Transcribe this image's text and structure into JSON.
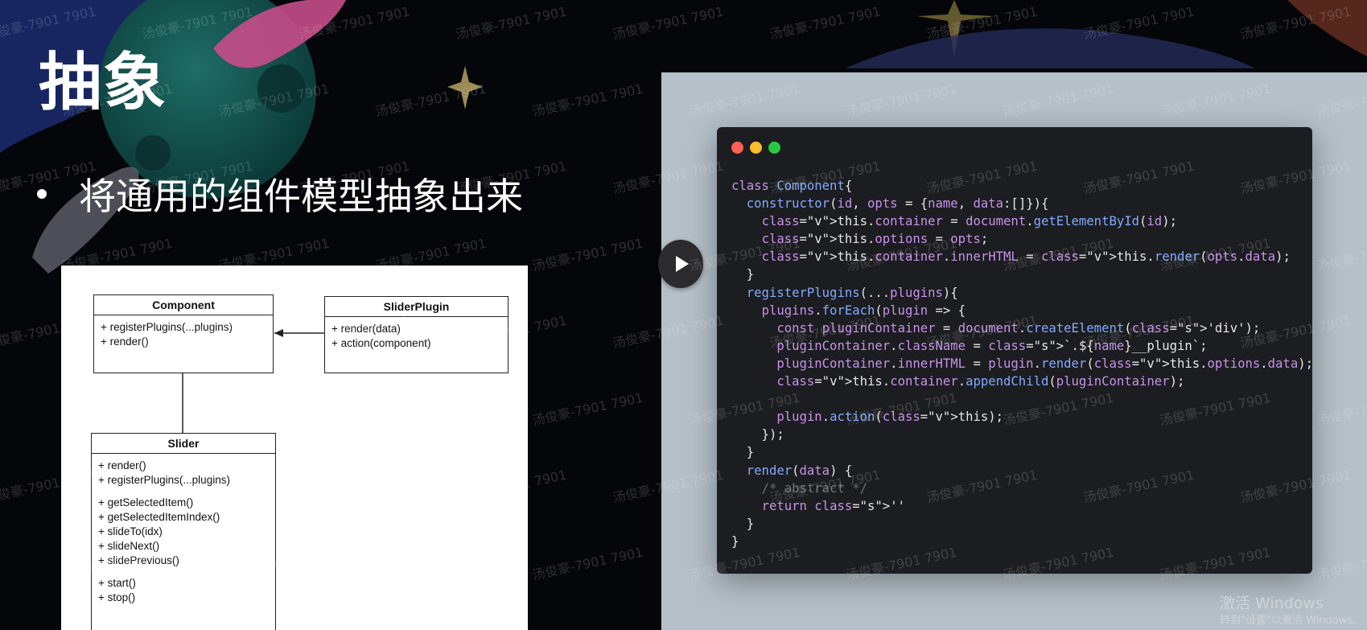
{
  "slide": {
    "title": "抽象",
    "bullet": "将通用的组件模型抽象出来"
  },
  "uml": {
    "component": {
      "name": "Component",
      "methods": [
        "+ registerPlugins(...plugins)",
        "+ render()"
      ]
    },
    "slider_plugin": {
      "name": "SliderPlugin",
      "methods": [
        "+ render(data)",
        "+ action(component)"
      ]
    },
    "slider": {
      "name": "Slider",
      "group1": [
        "+ render()",
        "+ registerPlugins(...plugins)"
      ],
      "group2": [
        "+ getSelectedItem()",
        "+ getSelectedItemIndex()",
        "+ slideTo(idx)",
        "+ slideNext()",
        "+ slidePrevious()"
      ],
      "group3": [
        "+ start()",
        "+ stop()"
      ]
    }
  },
  "code_window": {
    "lines": [
      "class Component{",
      "  constructor(id, opts = {name, data:[]}){",
      "    this.container = document.getElementById(id);",
      "    this.options = opts;",
      "    this.container.innerHTML = this.render(opts.data);",
      "  }",
      "  registerPlugins(...plugins){",
      "    plugins.forEach(plugin => {",
      "      const pluginContainer = document.createElement('div');",
      "      pluginContainer.className = `.${name}__plugin`;",
      "      pluginContainer.innerHTML = plugin.render(this.options.data);",
      "      this.container.appendChild(pluginContainer);",
      "",
      "      plugin.action(this);",
      "    });",
      "  }",
      "  render(data) {",
      "    /* abstract */",
      "    return ''",
      "  }",
      "}"
    ]
  },
  "watermark": "汤俊豪-7901 7901",
  "windows_activation": {
    "line1": "激活 Windows",
    "line2": "转到\"设置\"以激活 Windows。"
  },
  "icons": {
    "play": "play-icon",
    "traffic_lights": [
      "close-dot",
      "minimize-dot",
      "zoom-dot"
    ]
  },
  "colors": {
    "code_bg": "#1c1d20",
    "keyword": "#c792ea",
    "function": "#82aaff",
    "this": "#d6c24a",
    "string": "#8bd18c"
  }
}
